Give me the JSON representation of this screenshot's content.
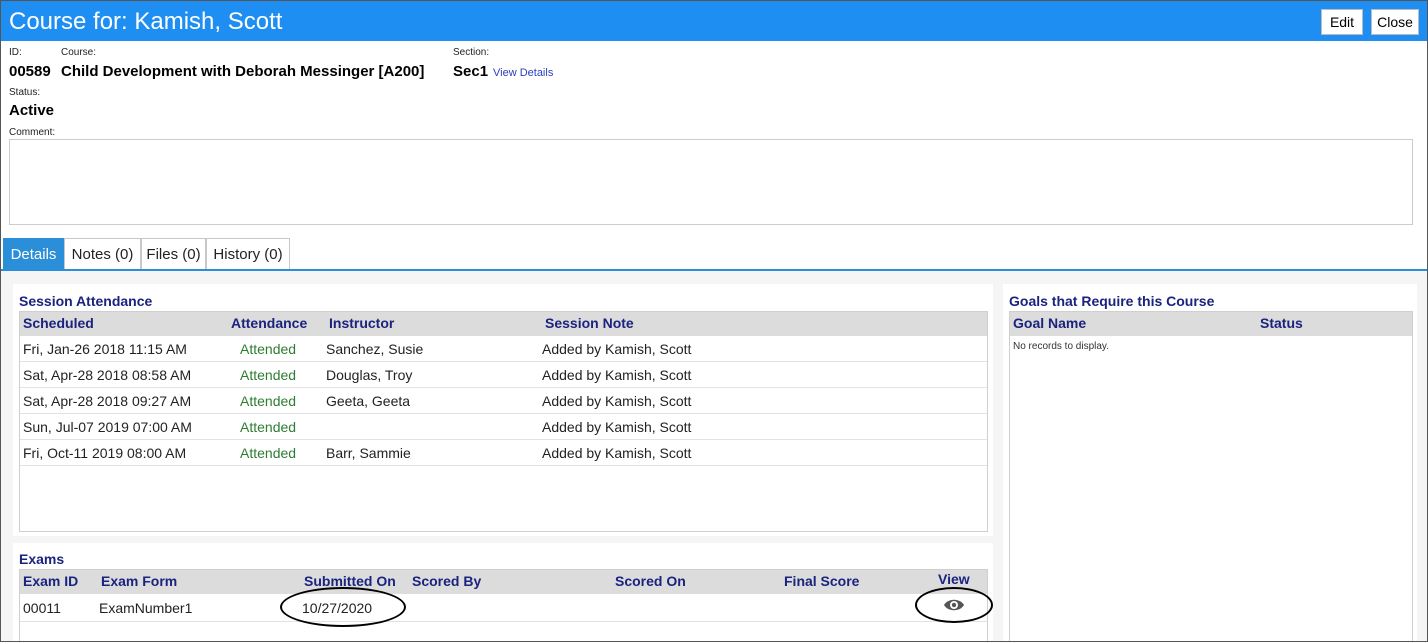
{
  "window": {
    "title": "Course for: Kamish, Scott",
    "edit_label": "Edit",
    "close_label": "Close"
  },
  "header": {
    "id_label": "ID:",
    "id_value": "00589",
    "course_label": "Course:",
    "course_value": "Child Development with Deborah Messinger [A200]",
    "section_label": "Section:",
    "section_value": "Sec1",
    "view_details": "View Details",
    "status_label": "Status:",
    "status_value": "Active",
    "comment_label": "Comment:"
  },
  "tabs": [
    {
      "label": "Details",
      "active": true
    },
    {
      "label": "Notes (0)",
      "active": false
    },
    {
      "label": "Files (0)",
      "active": false
    },
    {
      "label": "History (0)",
      "active": false
    }
  ],
  "attendance": {
    "title": "Session Attendance",
    "columns": [
      "Scheduled",
      "Attendance",
      "Instructor",
      "Session Note"
    ],
    "rows": [
      [
        "Fri, Jan-26 2018 11:15 AM",
        "Attended",
        "Sanchez, Susie",
        "Added by Kamish, Scott"
      ],
      [
        "Sat, Apr-28 2018 08:58 AM",
        "Attended",
        "Douglas, Troy",
        "Added by Kamish, Scott"
      ],
      [
        "Sat, Apr-28 2018 09:27 AM",
        "Attended",
        "Geeta, Geeta",
        "Added by Kamish, Scott"
      ],
      [
        "Sun, Jul-07 2019 07:00 AM",
        "Attended",
        "",
        "Added by Kamish, Scott"
      ],
      [
        "Fri, Oct-11 2019 08:00 AM",
        "Attended",
        "Barr, Sammie",
        "Added by Kamish, Scott"
      ]
    ]
  },
  "exams": {
    "title": "Exams",
    "columns": [
      "Exam ID",
      "Exam Form",
      "Submitted On",
      "Scored By",
      "Scored On",
      "Final Score",
      "View"
    ],
    "rows": [
      [
        "00011",
        "ExamNumber1",
        "10/27/2020",
        "",
        "",
        "",
        ""
      ]
    ]
  },
  "goals": {
    "title": "Goals that Require this Course",
    "columns": [
      "Goal Name",
      "Status"
    ],
    "empty_text": "No records to display."
  },
  "icons": {
    "view": "eye-icon"
  },
  "colors": {
    "titlebar": "#1e8ef2",
    "active_tab": "#2b8ed8",
    "heading": "#1a237e",
    "attended": "#2e7d32"
  }
}
